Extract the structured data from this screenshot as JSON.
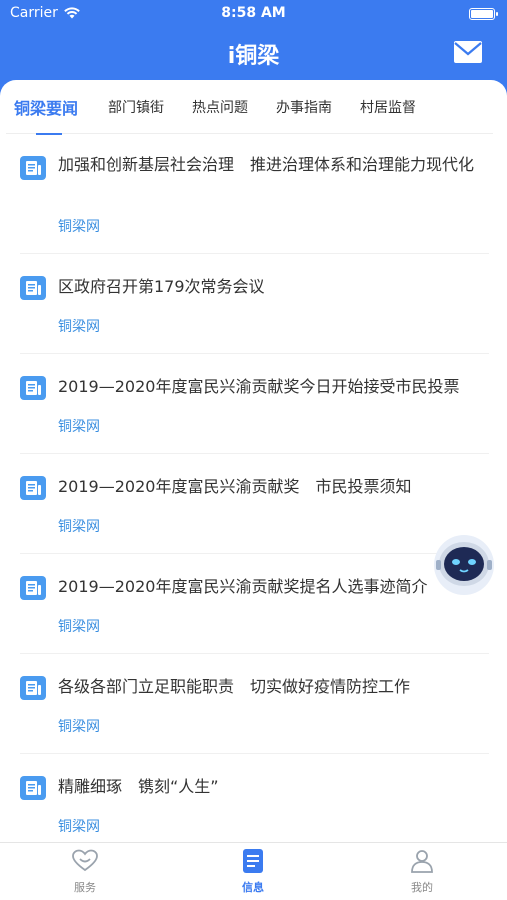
{
  "status_bar": {
    "carrier": "Carrier",
    "time": "8:58 AM"
  },
  "nav": {
    "title": "i铜梁"
  },
  "tabs": [
    {
      "label": "铜梁要闻",
      "active": true
    },
    {
      "label": "部门镇街"
    },
    {
      "label": "热点问题"
    },
    {
      "label": "办事指南"
    },
    {
      "label": "村居监督"
    }
  ],
  "news": [
    {
      "title": "加强和创新基层社会治理　推进治理体系和治理能力现代化",
      "source": "铜梁网"
    },
    {
      "title": "区政府召开第179次常务会议",
      "source": "铜梁网"
    },
    {
      "title": "2019—2020年度富民兴渝贡献奖今日开始接受市民投票",
      "source": "铜梁网"
    },
    {
      "title": "2019—2020年度富民兴渝贡献奖　市民投票须知",
      "source": "铜梁网"
    },
    {
      "title": "2019—2020年度富民兴渝贡献奖提名人选事迹简介",
      "source": "铜梁网"
    },
    {
      "title": "各级各部门立足职能职责　切实做好疫情防控工作",
      "source": "铜梁网"
    },
    {
      "title": "精雕细琢　镌刻“人生”",
      "source": "铜梁网"
    }
  ],
  "tabbar": [
    {
      "label": "服务",
      "icon": "heart-icon"
    },
    {
      "label": "信息",
      "icon": "document-icon",
      "active": true
    },
    {
      "label": "我的",
      "icon": "person-icon"
    }
  ],
  "colors": {
    "primary": "#3b7bf0",
    "source": "#3b8fe0",
    "icon_bg": "#4a9bf0"
  }
}
